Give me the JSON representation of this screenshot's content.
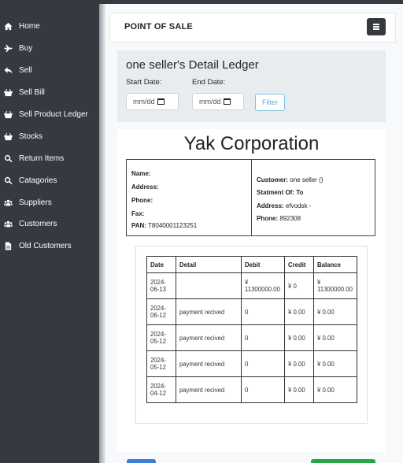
{
  "sidebar": {
    "items": [
      {
        "label": "Home",
        "icon": "home-icon"
      },
      {
        "label": "Buy",
        "icon": "plane-icon"
      },
      {
        "label": "Sell",
        "icon": "reply-icon"
      },
      {
        "label": "Sell Bill",
        "icon": "basket-icon"
      },
      {
        "label": "Sell Product Ledger",
        "icon": "basket-icon"
      },
      {
        "label": "Stocks",
        "icon": "basket-icon"
      },
      {
        "label": "Return Items",
        "icon": "search-icon"
      },
      {
        "label": "Catagories",
        "icon": "search-icon"
      },
      {
        "label": "Suppliers",
        "icon": "users-icon"
      },
      {
        "label": "Customers",
        "icon": "users-icon"
      },
      {
        "label": "Old Customers",
        "icon": "file-icon"
      }
    ]
  },
  "header": {
    "title": "POINT OF SALE"
  },
  "filter": {
    "title": "one seller's Detail Ledger",
    "start_label": "Start Date:",
    "end_label": "End Date:",
    "start_placeholder": "mm/dd",
    "end_placeholder": "mm/dd",
    "filter_button": "Filter"
  },
  "report": {
    "company": "Yak Corporation",
    "left": {
      "name_label": "Name:",
      "address_label": "Address:",
      "phone_label": "Phone:",
      "fax_label": "Fax:",
      "pan_label": "PAN:",
      "pan_value": "T8040001123251"
    },
    "right": {
      "customer_label": "Customer:",
      "customer_value": "one seller ()",
      "statement_label": "Statment Of: To",
      "address_label": "Address:",
      "address_value": "efvodsk -",
      "phone_label": "Phone:",
      "phone_value": "892308"
    },
    "table": {
      "headers": [
        "Date",
        "Detail",
        "Debit",
        "Credit",
        "Balance"
      ],
      "rows": [
        {
          "date_1": "2024-",
          "date_2": "06-13",
          "detail": "",
          "debit_1": "¥",
          "debit_2": "11300000.00",
          "credit": "¥ 0",
          "balance_1": "¥",
          "balance_2": "11300000.00"
        },
        {
          "date_1": "2024-",
          "date_2": "06-12",
          "detail": "payment recived",
          "debit_1": "0",
          "debit_2": "",
          "credit": "¥ 0.00",
          "balance_1": "¥ 0.00",
          "balance_2": ""
        },
        {
          "date_1": "2024-",
          "date_2": "05-12",
          "detail": "payment recived",
          "debit_1": "0",
          "debit_2": "",
          "credit": "¥ 0.00",
          "balance_1": "¥ 0.00",
          "balance_2": ""
        },
        {
          "date_1": "2024-",
          "date_2": "05-12",
          "detail": "payment recived",
          "debit_1": "0",
          "debit_2": "",
          "credit": "¥ 0.00",
          "balance_1": "¥ 0.00",
          "balance_2": ""
        },
        {
          "date_1": "2024-",
          "date_2": "04-12",
          "detail": "payment recived",
          "debit_1": "0",
          "debit_2": "",
          "credit": "¥ 0.00",
          "balance_1": "¥ 0.00",
          "balance_2": ""
        }
      ]
    }
  },
  "colors": {
    "sidebar": "#343a40",
    "accent": "#5fb1d3",
    "primary": "#3b7ddd",
    "success": "#28a745"
  }
}
